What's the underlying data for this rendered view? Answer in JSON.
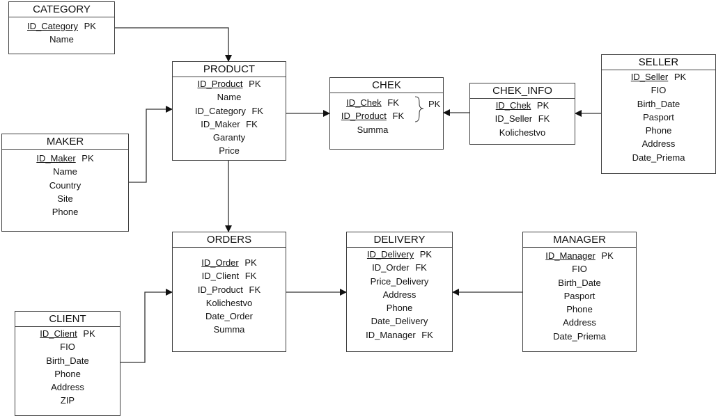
{
  "entities": [
    {
      "id": "category",
      "title": "CATEGORY",
      "fields": [
        {
          "name": "ID_Category",
          "key": "PK",
          "underline": true
        },
        {
          "name": "Name",
          "key": "",
          "underline": false
        }
      ]
    },
    {
      "id": "product",
      "title": "PRODUCT",
      "fields": [
        {
          "name": "ID_Product",
          "key": "PK",
          "underline": true
        },
        {
          "name": "Name",
          "key": "",
          "underline": false
        },
        {
          "name": "ID_Category",
          "key": "FK",
          "underline": false
        },
        {
          "name": "ID_Maker",
          "key": "FK",
          "underline": false
        },
        {
          "name": "Garanty",
          "key": "",
          "underline": false
        },
        {
          "name": "Price",
          "key": "",
          "underline": false
        }
      ]
    },
    {
      "id": "maker",
      "title": "MAKER",
      "fields": [
        {
          "name": "ID_Maker",
          "key": "PK",
          "underline": true
        },
        {
          "name": "Name",
          "key": "",
          "underline": false
        },
        {
          "name": "Country",
          "key": "",
          "underline": false
        },
        {
          "name": "Site",
          "key": "",
          "underline": false
        },
        {
          "name": "Phone",
          "key": "",
          "underline": false
        }
      ]
    },
    {
      "id": "chek",
      "title": "CHEK",
      "fields": [
        {
          "name": "ID_Chek",
          "key": "FK",
          "underline": true
        },
        {
          "name": "ID_Product",
          "key": "FK",
          "underline": true
        },
        {
          "name": "Summa",
          "key": "",
          "underline": false
        }
      ],
      "composite_key": "PK"
    },
    {
      "id": "chek_info",
      "title": "CHEK_INFO",
      "fields": [
        {
          "name": "ID_Chek",
          "key": "PK",
          "underline": true
        },
        {
          "name": "ID_Seller",
          "key": "FK",
          "underline": false
        },
        {
          "name": "Kolichestvo",
          "key": "",
          "underline": false
        }
      ]
    },
    {
      "id": "seller",
      "title": "SELLER",
      "fields": [
        {
          "name": "ID_Seller",
          "key": "PK",
          "underline": true
        },
        {
          "name": "FIO",
          "key": "",
          "underline": false
        },
        {
          "name": "Birth_Date",
          "key": "",
          "underline": false
        },
        {
          "name": "Pasport",
          "key": "",
          "underline": false
        },
        {
          "name": "Phone",
          "key": "",
          "underline": false
        },
        {
          "name": "Address",
          "key": "",
          "underline": false
        },
        {
          "name": "Date_Priema",
          "key": "",
          "underline": false
        }
      ]
    },
    {
      "id": "orders",
      "title": "ORDERS",
      "fields": [
        {
          "name": "ID_Order",
          "key": "PK",
          "underline": true
        },
        {
          "name": "ID_Client",
          "key": "FK",
          "underline": false
        },
        {
          "name": "ID_Product",
          "key": "FK",
          "underline": false
        },
        {
          "name": "Kolichestvo",
          "key": "",
          "underline": false
        },
        {
          "name": "Date_Order",
          "key": "",
          "underline": false
        },
        {
          "name": "Summa",
          "key": "",
          "underline": false
        }
      ]
    },
    {
      "id": "delivery",
      "title": "DELIVERY",
      "fields": [
        {
          "name": "ID_Delivery",
          "key": "PK",
          "underline": true
        },
        {
          "name": "ID_Order",
          "key": "FK",
          "underline": false
        },
        {
          "name": "Price_Delivery",
          "key": "",
          "underline": false
        },
        {
          "name": "Address",
          "key": "",
          "underline": false
        },
        {
          "name": "Phone",
          "key": "",
          "underline": false
        },
        {
          "name": "Date_Delivery",
          "key": "",
          "underline": false
        },
        {
          "name": "ID_Manager",
          "key": "FK",
          "underline": false
        }
      ]
    },
    {
      "id": "manager",
      "title": "MANAGER",
      "fields": [
        {
          "name": "ID_Manager",
          "key": "PK",
          "underline": true
        },
        {
          "name": "FIO",
          "key": "",
          "underline": false
        },
        {
          "name": "Birth_Date",
          "key": "",
          "underline": false
        },
        {
          "name": "Pasport",
          "key": "",
          "underline": false
        },
        {
          "name": "Phone",
          "key": "",
          "underline": false
        },
        {
          "name": "Address",
          "key": "",
          "underline": false
        },
        {
          "name": "Date_Priema",
          "key": "",
          "underline": false
        }
      ]
    },
    {
      "id": "client",
      "title": "CLIENT",
      "fields": [
        {
          "name": "ID_Client",
          "key": "PK",
          "underline": true
        },
        {
          "name": "FIO",
          "key": "",
          "underline": false
        },
        {
          "name": "Birth_Date",
          "key": "",
          "underline": false
        },
        {
          "name": "Phone",
          "key": "",
          "underline": false
        },
        {
          "name": "Address",
          "key": "",
          "underline": false
        },
        {
          "name": "ZIP",
          "key": "",
          "underline": false
        }
      ]
    }
  ],
  "relationships": [
    {
      "from": "category",
      "to": "product"
    },
    {
      "from": "maker",
      "to": "product"
    },
    {
      "from": "product",
      "to": "chek"
    },
    {
      "from": "chek_info",
      "to": "chek"
    },
    {
      "from": "seller",
      "to": "chek_info"
    },
    {
      "from": "product",
      "to": "orders"
    },
    {
      "from": "client",
      "to": "orders"
    },
    {
      "from": "orders",
      "to": "delivery"
    },
    {
      "from": "manager",
      "to": "delivery"
    }
  ]
}
